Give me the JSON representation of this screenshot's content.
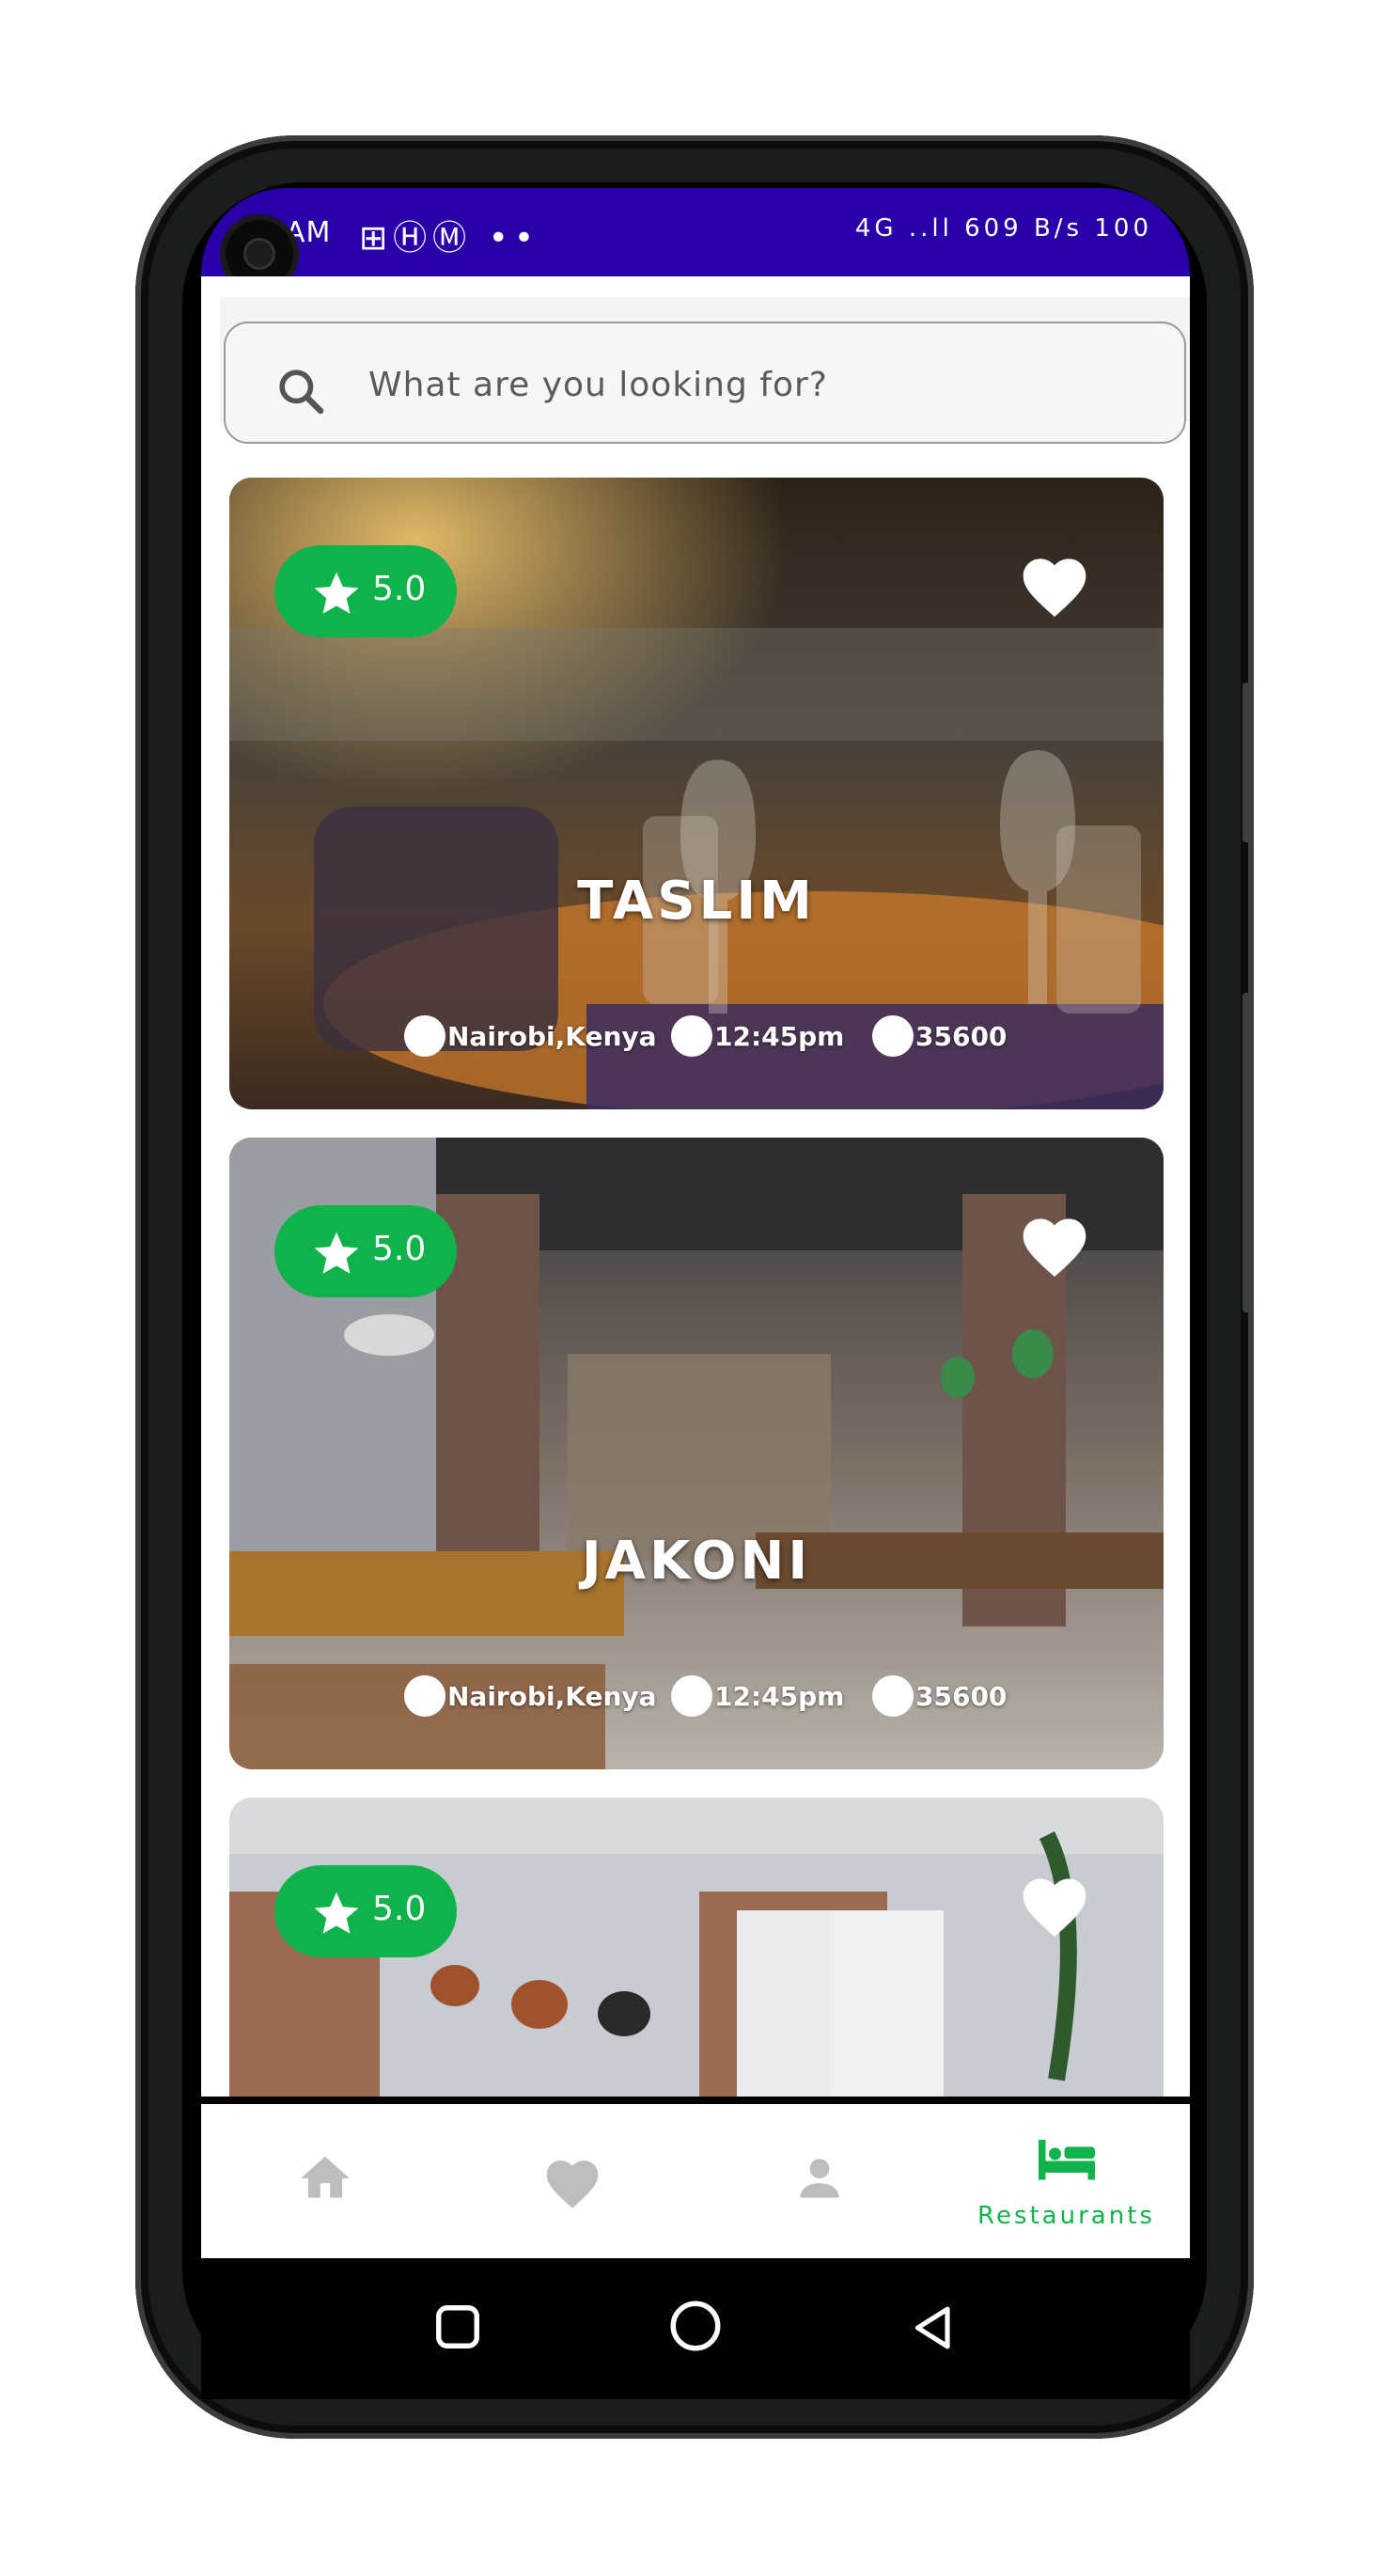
{
  "status_bar": {
    "time": "AM",
    "left_icons": "⊞ⒽⓂ ••",
    "right_icons": "4G ..ll  609 B/s  100"
  },
  "search": {
    "placeholder": "What are you looking for?",
    "value": ""
  },
  "restaurants": [
    {
      "name": "TASLIM",
      "rating": "5.0",
      "location": "Nairobi,Kenya",
      "time": "12:45pm",
      "price": "35600"
    },
    {
      "name": "JAKONI",
      "rating": "5.0",
      "location": "Nairobi,Kenya",
      "time": "12:45pm",
      "price": "35600"
    },
    {
      "name": "",
      "rating": "5.0",
      "location": "",
      "time": "",
      "price": ""
    }
  ],
  "bottom_nav": {
    "items": [
      {
        "icon": "home-icon",
        "label": ""
      },
      {
        "icon": "heart-icon",
        "label": ""
      },
      {
        "icon": "person-icon",
        "label": ""
      },
      {
        "icon": "bed-icon",
        "label": "Restaurants"
      }
    ],
    "active_index": 3
  },
  "colors": {
    "status_bar": "#2a00a8",
    "accent_green": "#10b34b",
    "inactive_icon": "#bdbdbd"
  }
}
